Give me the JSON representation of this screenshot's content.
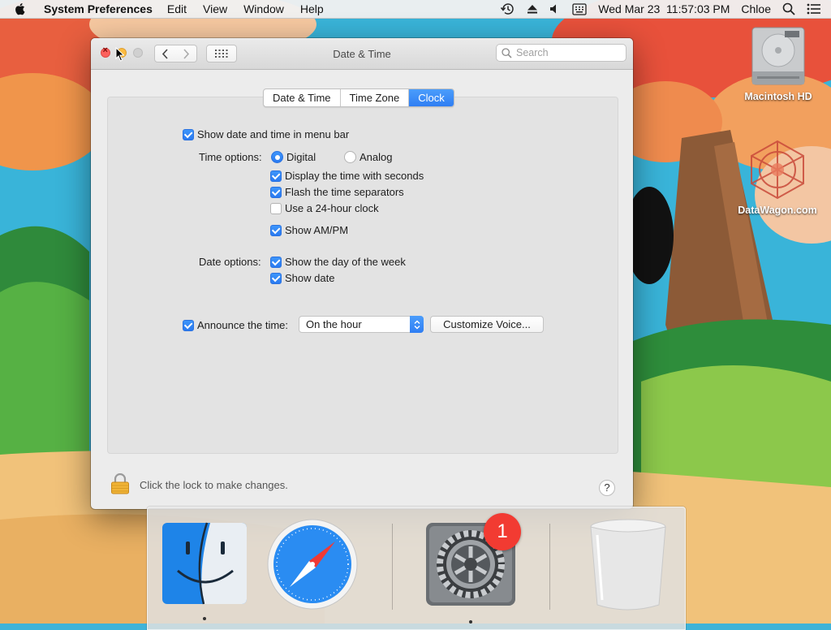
{
  "menubar": {
    "app_name": "System Preferences",
    "menus": [
      "Edit",
      "View",
      "Window",
      "Help"
    ],
    "status": {
      "icons": [
        "time-machine-icon",
        "eject-icon",
        "volume-icon",
        "keyboard-viewer-icon"
      ],
      "datetime": "Wed Mar 23  11:57:03 PM",
      "user": "Chloe"
    }
  },
  "window": {
    "title": "Date & Time",
    "search_placeholder": "Search",
    "tabs": [
      {
        "label": "Date & Time",
        "active": false
      },
      {
        "label": "Time Zone",
        "active": false
      },
      {
        "label": "Clock",
        "active": true
      }
    ],
    "show_in_menu_bar": {
      "label": "Show date and time in menu bar",
      "checked": true
    },
    "time_options": {
      "label": "Time options:",
      "digital": {
        "label": "Digital",
        "selected": true
      },
      "analog": {
        "label": "Analog",
        "selected": false
      },
      "display_seconds": {
        "label": "Display the time with seconds",
        "checked": true
      },
      "flash_separators": {
        "label": "Flash the time separators",
        "checked": true
      },
      "use_24_hour": {
        "label": "Use a 24-hour clock",
        "checked": false
      },
      "show_ampm": {
        "label": "Show AM/PM",
        "checked": true
      }
    },
    "date_options": {
      "label": "Date options:",
      "show_day_of_week": {
        "label": "Show the day of the week",
        "checked": true
      },
      "show_date": {
        "label": "Show date",
        "checked": true
      }
    },
    "announce": {
      "label": "Announce the time:",
      "checked": true,
      "interval": "On the hour",
      "customize_button": "Customize Voice..."
    },
    "lock_text": "Click the lock to make changes.",
    "help_label": "?"
  },
  "desktop": {
    "icons": [
      {
        "label": "Macintosh HD",
        "icon": "hard-drive-icon"
      },
      {
        "label": "DataWagon.com",
        "icon": "datawagon-icon"
      }
    ]
  },
  "dock": {
    "items": [
      {
        "name": "Finder",
        "icon": "finder-icon",
        "running": true
      },
      {
        "name": "Safari",
        "icon": "safari-icon",
        "running": false
      },
      {
        "name": "System Preferences",
        "icon": "system-preferences-icon",
        "running": true,
        "badge": "1"
      },
      {
        "name": "Trash",
        "icon": "trash-icon",
        "running": false
      }
    ]
  },
  "colors": {
    "accent": "#2f7ef3",
    "close": "#fc605c",
    "minimize": "#fdbc40",
    "badge": "#f23b32"
  }
}
